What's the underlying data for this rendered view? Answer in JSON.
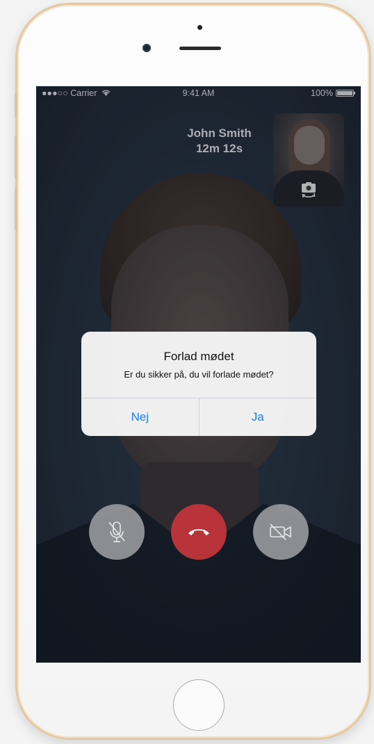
{
  "status_bar": {
    "signal_carrier": "●●●○○ Carrier",
    "time": "9:41 AM",
    "battery_percent": "100%"
  },
  "call": {
    "caller_name": "John Smith",
    "duration": "12m 12s"
  },
  "alert": {
    "title": "Forlad mødet",
    "message": "Er du sikker på, du vil forlade mødet?",
    "cancel_label": "Nej",
    "confirm_label": "Ja"
  },
  "controls": {
    "mute_icon": "mic-off-icon",
    "end_icon": "phone-hangup-icon",
    "video_icon": "video-off-icon",
    "end_color": "#b8343a"
  },
  "colors": {
    "accent": "#1f7cf0",
    "bezel": "#e2c9a3"
  }
}
